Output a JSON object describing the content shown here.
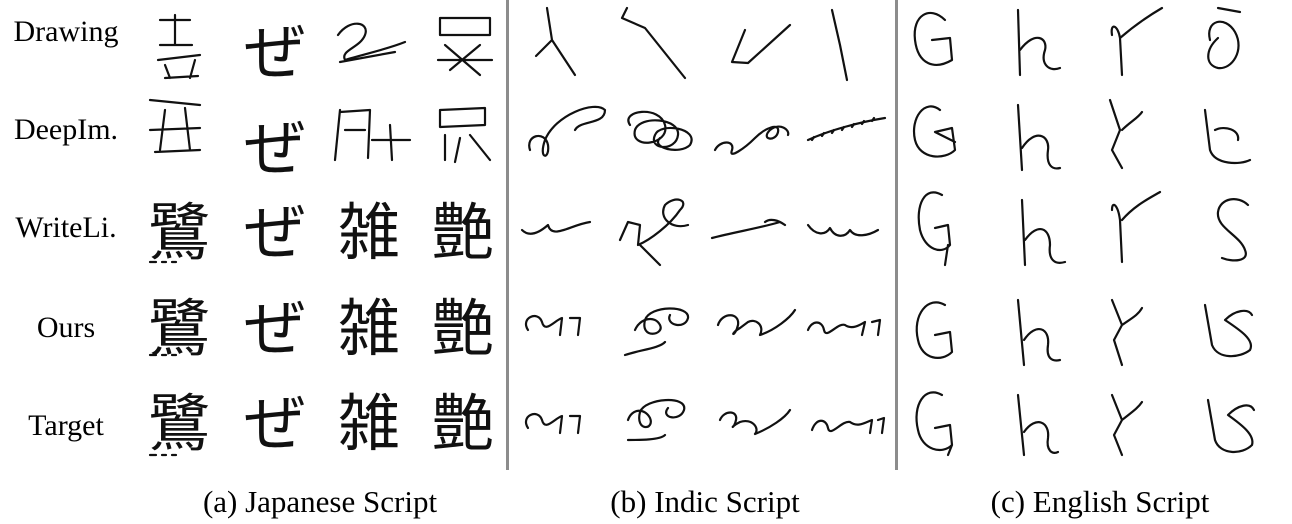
{
  "rows": [
    "Drawing",
    "DeepIm.",
    "WriteLi.",
    "Ours",
    "Target"
  ],
  "captions": {
    "japanese": "(a) Japanese Script",
    "indic": "(b) Indic Script",
    "english": "(c) English Script"
  },
  "japanese_glyphs": [
    [
      "",
      "ぜ",
      "",
      ""
    ],
    [
      "",
      "ぜ",
      "",
      ""
    ],
    [
      "鷺",
      "ぜ",
      "雑",
      "艶"
    ],
    [
      "鷺",
      "ぜ",
      "雑",
      "艶"
    ],
    [
      "鷺",
      "ぜ",
      "雑",
      "艶"
    ]
  ]
}
